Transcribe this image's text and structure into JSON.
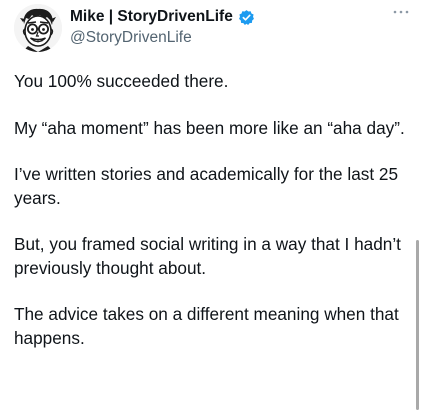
{
  "author": {
    "display_name": "Mike | StoryDrivenLife",
    "handle": "@StoryDrivenLife",
    "verified": true,
    "avatar_icon": "cartoon-man-with-glasses-avatar"
  },
  "menu": {
    "icon": "more-horizontal-icon"
  },
  "tweet": {
    "paragraphs": [
      "You 100% succeeded there.",
      "My “aha moment” has been more like an “aha day”.",
      "I’ve written stories and academically for the last 25 years.",
      "But, you framed social writing in a way that I hadn’t previously thought about.",
      "The advice takes on a different meaning when that happens."
    ]
  },
  "colors": {
    "text": "#0f1419",
    "secondary_text": "#536471",
    "verified_badge": "#1d9bf0"
  }
}
